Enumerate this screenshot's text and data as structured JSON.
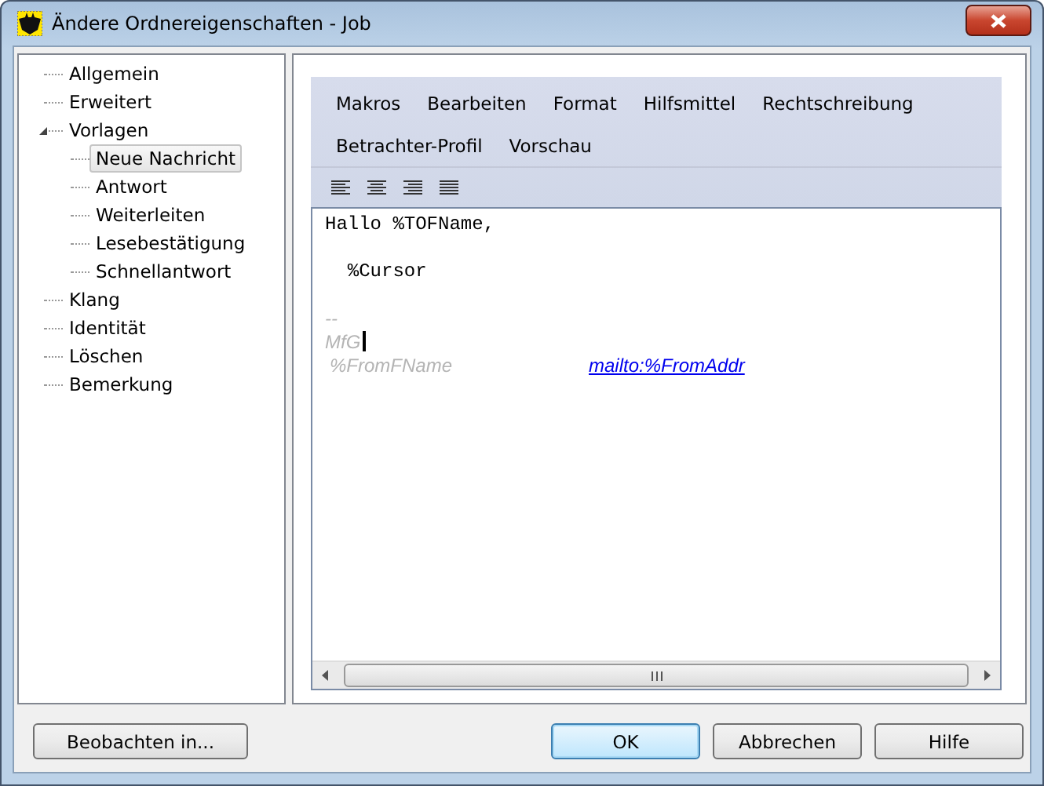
{
  "window": {
    "title": "Ändere Ordnereigenschaften - Job"
  },
  "tree": [
    {
      "label": "Allgemein",
      "selected": false
    },
    {
      "label": "Erweitert",
      "selected": false
    },
    {
      "label": "Vorlagen",
      "selected": false,
      "expanded": true,
      "children": [
        {
          "label": "Neue Nachricht",
          "selected": true
        },
        {
          "label": "Antwort",
          "selected": false
        },
        {
          "label": "Weiterleiten",
          "selected": false
        },
        {
          "label": "Lesebestätigung",
          "selected": false
        },
        {
          "label": "Schnellantwort",
          "selected": false
        }
      ]
    },
    {
      "label": "Klang",
      "selected": false
    },
    {
      "label": "Identität",
      "selected": false
    },
    {
      "label": "Löschen",
      "selected": false
    },
    {
      "label": "Bemerkung",
      "selected": false
    }
  ],
  "menu_rows": [
    [
      "Makros",
      "Bearbeiten",
      "Format",
      "Hilfsmittel",
      "Rechtschreibung"
    ],
    [
      "Betrachter-Profil",
      "Vorschau"
    ]
  ],
  "align_buttons": [
    {
      "kind": "left"
    },
    {
      "kind": "center"
    },
    {
      "kind": "right"
    },
    {
      "kind": "justify"
    }
  ],
  "editor": {
    "lines": [
      {
        "kind": "code",
        "text": "Hallo %TOFName,"
      },
      {
        "kind": "blank"
      },
      {
        "kind": "code",
        "text": "  %Cursor"
      },
      {
        "kind": "blank"
      },
      {
        "kind": "sig",
        "text": "--"
      },
      {
        "kind": "sig",
        "text": "MfG",
        "cursor": true
      },
      {
        "kind": "sigrow",
        "text": "%FromFName",
        "link": "mailto:%FromAddr"
      }
    ]
  },
  "buttons": {
    "left": "Beobachten in...",
    "right": [
      {
        "label": "OK",
        "default": true
      },
      {
        "label": "Abbrechen",
        "default": false
      },
      {
        "label": "Hilfe",
        "default": false
      }
    ]
  }
}
